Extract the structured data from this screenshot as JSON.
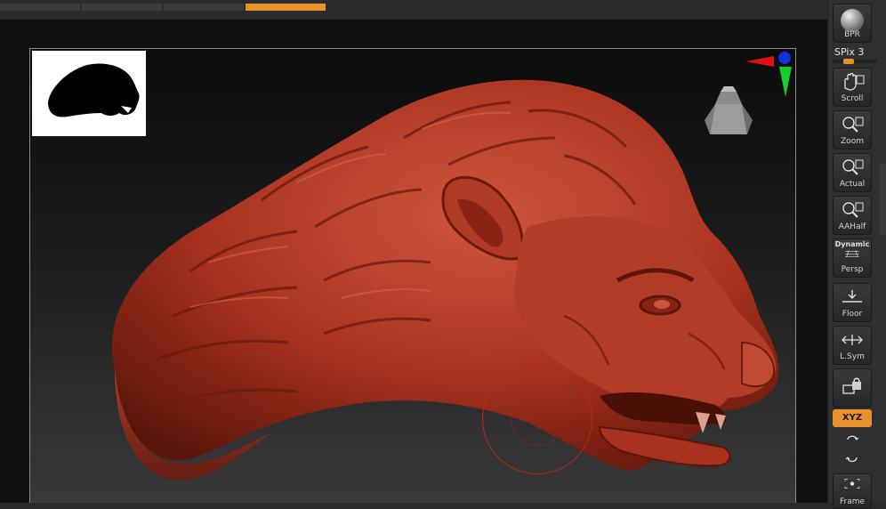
{
  "right_panel": {
    "bpr_label": "BPR",
    "spix_label": "SPix 3",
    "spix_level": 0.3,
    "buttons": [
      {
        "label": "Scroll",
        "icon": "hand-scroll-icon"
      },
      {
        "label": "Zoom",
        "icon": "zoom-magnifier-icon"
      },
      {
        "label": "Actual",
        "icon": "actual-size-icon"
      },
      {
        "label": "AAHalf",
        "icon": "aahalf-icon"
      },
      {
        "label": "Persp",
        "icon": "perspective-grid-icon",
        "sub": "Dynamic"
      },
      {
        "label": "Floor",
        "icon": "floor-icon"
      },
      {
        "label": "L.Sym",
        "icon": "local-symmetry-icon"
      },
      {
        "label": "",
        "icon": "lock-camera-icon"
      },
      {
        "label": "Frame",
        "icon": "frame-icon"
      }
    ],
    "xyz_label": "XYZ"
  },
  "colors": {
    "accent": "#e8912f",
    "model": "#a8321f",
    "brush_cursor": "#c0261b",
    "gyro_red": "#e01010",
    "gyro_blue": "#1030e0",
    "gyro_green": "#10d030"
  },
  "viewport": {
    "model_subject": "lion-head-sculpt",
    "thumbnail": "silhouette-thumbnail"
  }
}
